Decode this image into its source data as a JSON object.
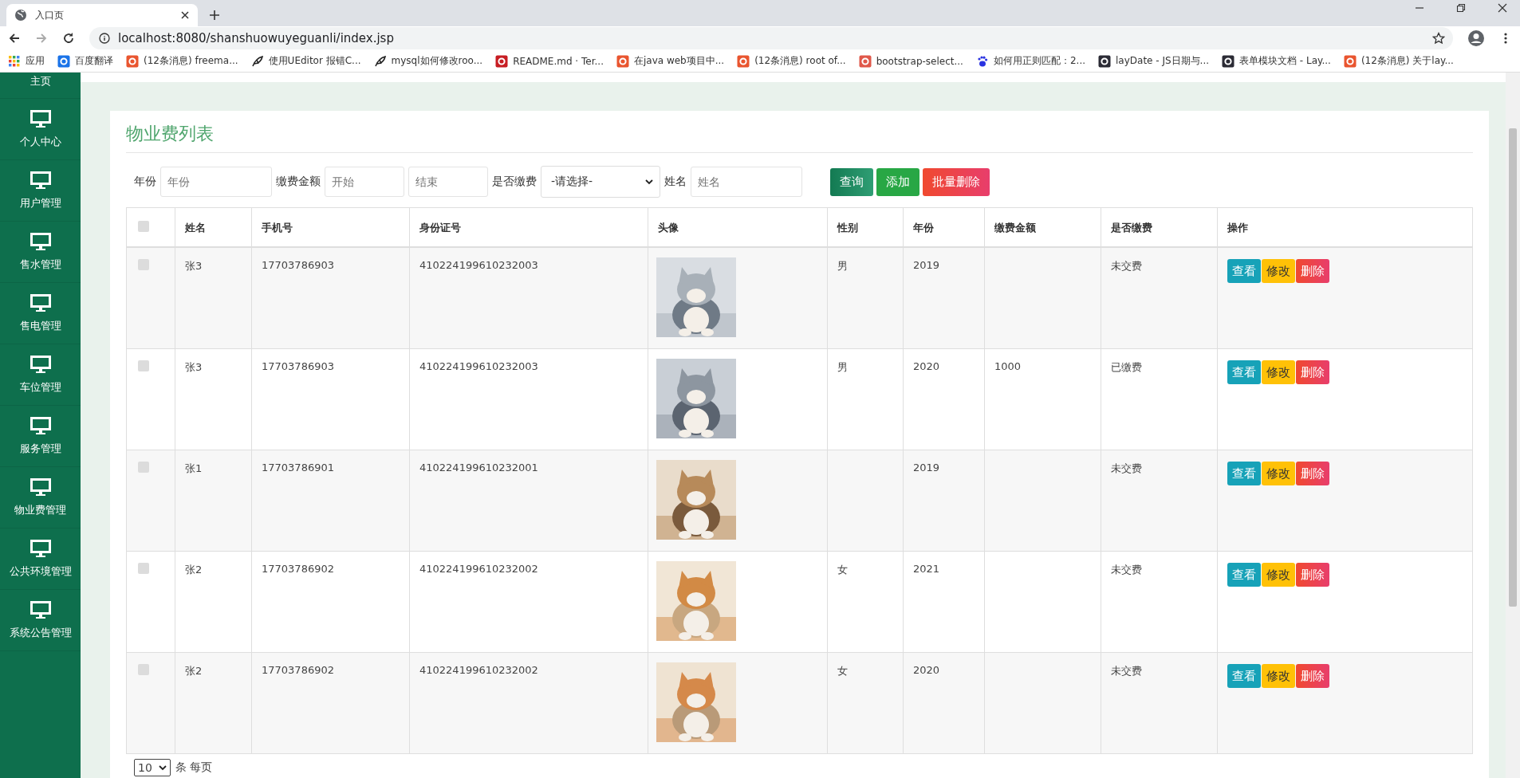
{
  "browser": {
    "tab_title": "入口页",
    "url": "localhost:8080/shanshuowuyeguanli/index.jsp",
    "bookmarks": [
      {
        "kind": "apps",
        "label": "应用"
      },
      {
        "kind": "translate",
        "label": "百度翻译"
      },
      {
        "kind": "csdn",
        "label": "(12条消息) freema..."
      },
      {
        "kind": "feather",
        "label": "使用UEditor 报错C..."
      },
      {
        "kind": "feather",
        "label": "mysql如何修改roo..."
      },
      {
        "kind": "gitee",
        "label": "README.md · Ter..."
      },
      {
        "kind": "csdn",
        "label": "在java web项目中..."
      },
      {
        "kind": "csdn",
        "label": "(12条消息) root of..."
      },
      {
        "kind": "jianshu",
        "label": "bootstrap-select..."
      },
      {
        "kind": "baidu",
        "label": "如何用正则匹配：2..."
      },
      {
        "kind": "layui",
        "label": "layDate - JS日期与..."
      },
      {
        "kind": "layui",
        "label": "表单模块文档 - Lay..."
      },
      {
        "kind": "csdn",
        "label": "(12条消息) 关于lay..."
      }
    ]
  },
  "sidebar": {
    "items": [
      {
        "label": "主页"
      },
      {
        "label": "个人中心"
      },
      {
        "label": "用户管理"
      },
      {
        "label": "售水管理"
      },
      {
        "label": "售电管理"
      },
      {
        "label": "车位管理"
      },
      {
        "label": "服务管理"
      },
      {
        "label": "物业费管理"
      },
      {
        "label": "公共环境管理"
      },
      {
        "label": "系统公告管理"
      }
    ]
  },
  "page_title": "物业费列表",
  "filters": {
    "year": {
      "label": "年份",
      "placeholder": "年份"
    },
    "amount": {
      "label": "缴费金额",
      "from_placeholder": "开始",
      "to_placeholder": "结束"
    },
    "paid": {
      "label": "是否缴费",
      "value": "-请选择-"
    },
    "name": {
      "label": "姓名",
      "placeholder": "姓名"
    },
    "buttons": [
      {
        "kind": "query",
        "label": "查询"
      },
      {
        "kind": "add",
        "label": "添加"
      },
      {
        "kind": "delete",
        "label": "批量删除"
      }
    ]
  },
  "table": {
    "select_all_checked": false,
    "columns": [
      "姓名",
      "手机号",
      "身份证号",
      "头像",
      "性别",
      "年份",
      "缴费金额",
      "是否缴费",
      "操作"
    ],
    "rows": [
      {
        "checked": false,
        "name": "张3",
        "phone": "17703786903",
        "id_number": "410224199610232003",
        "gender": "男",
        "year": "2019",
        "status": "未交费",
        "actions": [
          {
            "kind": "view",
            "label": "查看"
          },
          {
            "kind": "edit",
            "label": "修改"
          },
          {
            "kind": "delete",
            "label": "删除"
          }
        ]
      },
      {
        "checked": false,
        "name": "张3",
        "phone": "17703786903",
        "id_number": "410224199610232003",
        "gender": "男",
        "year": "2020",
        "amount": "1000",
        "status": "已缴费",
        "actions": [
          {
            "kind": "view",
            "label": "查看"
          },
          {
            "kind": "edit",
            "label": "修改"
          },
          {
            "kind": "delete",
            "label": "删除"
          }
        ]
      },
      {
        "checked": false,
        "name": "张1",
        "phone": "17703786901",
        "id_number": "410224199610232001",
        "year": "2019",
        "status": "未交费",
        "actions": [
          {
            "kind": "view",
            "label": "查看"
          },
          {
            "kind": "edit",
            "label": "修改"
          },
          {
            "kind": "delete",
            "label": "删除"
          }
        ]
      },
      {
        "checked": false,
        "name": "张2",
        "phone": "17703786902",
        "id_number": "410224199610232002",
        "gender": "女",
        "year": "2021",
        "status": "未交费",
        "actions": [
          {
            "kind": "view",
            "label": "查看"
          },
          {
            "kind": "edit",
            "label": "修改"
          },
          {
            "kind": "delete",
            "label": "删除"
          }
        ]
      },
      {
        "checked": false,
        "name": "张2",
        "phone": "17703786902",
        "id_number": "410224199610232002",
        "gender": "女",
        "year": "2020",
        "status": "未交费",
        "actions": [
          {
            "kind": "view",
            "label": "查看"
          },
          {
            "kind": "edit",
            "label": "修改"
          },
          {
            "kind": "delete",
            "label": "删除"
          }
        ]
      }
    ]
  },
  "pagination": {
    "page_size": "10",
    "suffix": "条 每页"
  }
}
